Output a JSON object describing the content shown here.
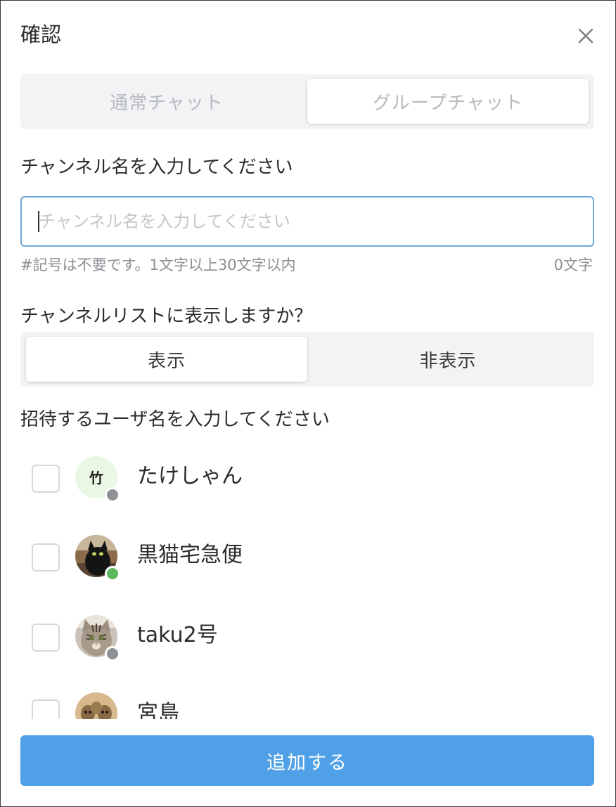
{
  "dialog": {
    "title": "確認"
  },
  "chat_type": {
    "options": [
      "通常チャット",
      "グループチャット"
    ],
    "selected": "グループチャット"
  },
  "channel_name": {
    "label": "チャンネル名を入力してください",
    "placeholder": "チャンネル名を入力してください",
    "value": "",
    "hint": "#記号は不要です。1文字以上30文字以内",
    "count": "0文字"
  },
  "visibility": {
    "label": "チャンネルリストに表示しますか？",
    "options": [
      "表示",
      "非表示"
    ],
    "selected": "表示"
  },
  "invite": {
    "label": "招待するユーザ名を入力してください",
    "users": [
      {
        "name": "たけしゃん",
        "avatar_text": "竹",
        "status": "offline",
        "checked": false
      },
      {
        "name": "黒猫宅急便",
        "avatar_text": "",
        "status": "online",
        "checked": false
      },
      {
        "name": "taku2号",
        "avatar_text": "",
        "status": "offline",
        "checked": false
      },
      {
        "name": "宮島",
        "avatar_text": "",
        "status": "",
        "checked": false
      }
    ]
  },
  "submit": {
    "label": "追加する"
  },
  "icons": {
    "close": "close-icon"
  },
  "colors": {
    "accent": "#4fa0e6",
    "input_border": "#6fa8d6",
    "online": "#5cb85c",
    "offline": "#8e9196",
    "segment_bg": "#f2f3f5"
  }
}
